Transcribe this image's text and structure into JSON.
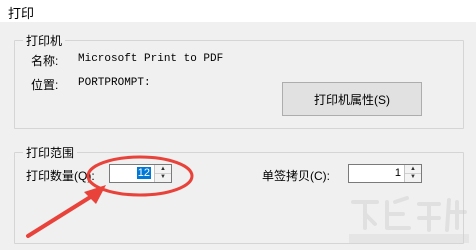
{
  "window": {
    "title": "打印"
  },
  "printer_group": {
    "title": "打印机",
    "name_label": "名称:",
    "name_value": "Microsoft Print to PDF",
    "location_label": "位置:",
    "location_value": "PORTPROMPT:",
    "properties_button": "打印机属性(S)"
  },
  "range_group": {
    "title": "打印范围",
    "copies_label": "打印数量(Q):",
    "copies_value": "12",
    "single_copy_label": "单签拷贝(C):",
    "single_copy_value": "1"
  },
  "annotation": {
    "color": "#e8423a"
  }
}
